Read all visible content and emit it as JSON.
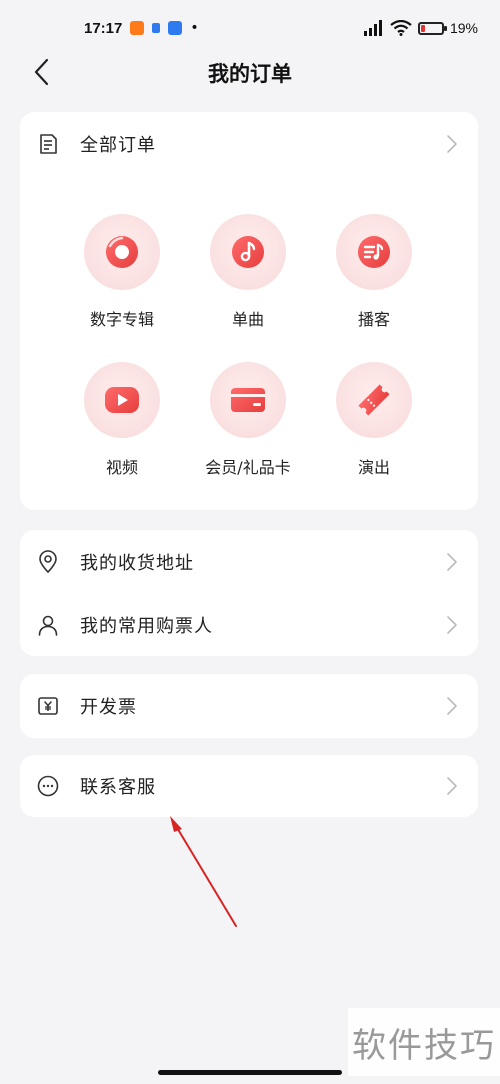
{
  "status_bar": {
    "time": "17:17",
    "battery_text": "19%",
    "battery_level": 0.19,
    "battery_color": "#e33333"
  },
  "nav": {
    "title": "我的订单"
  },
  "orders_card": {
    "header_label": "全部订单",
    "grid": [
      {
        "label": "数字专辑",
        "icon": "vinyl-icon"
      },
      {
        "label": "单曲",
        "icon": "music-note-icon"
      },
      {
        "label": "播客",
        "icon": "podcast-icon"
      },
      {
        "label": "视频",
        "icon": "play-icon"
      },
      {
        "label": "会员/礼品卡",
        "icon": "card-icon"
      },
      {
        "label": "演出",
        "icon": "ticket-icon"
      }
    ]
  },
  "address_card": {
    "items": [
      {
        "label": "我的收货地址",
        "icon": "location-pin-icon"
      },
      {
        "label": "我的常用购票人",
        "icon": "person-icon"
      }
    ]
  },
  "invoice_card": {
    "label": "开发票",
    "icon": "yen-receipt-icon"
  },
  "service_card": {
    "label": "联系客服",
    "icon": "chat-dots-icon"
  },
  "watermark": {
    "text": "软件技巧"
  },
  "colors": {
    "accent": "#ee4a4a",
    "background": "#f4f4f6",
    "card": "#ffffff"
  }
}
